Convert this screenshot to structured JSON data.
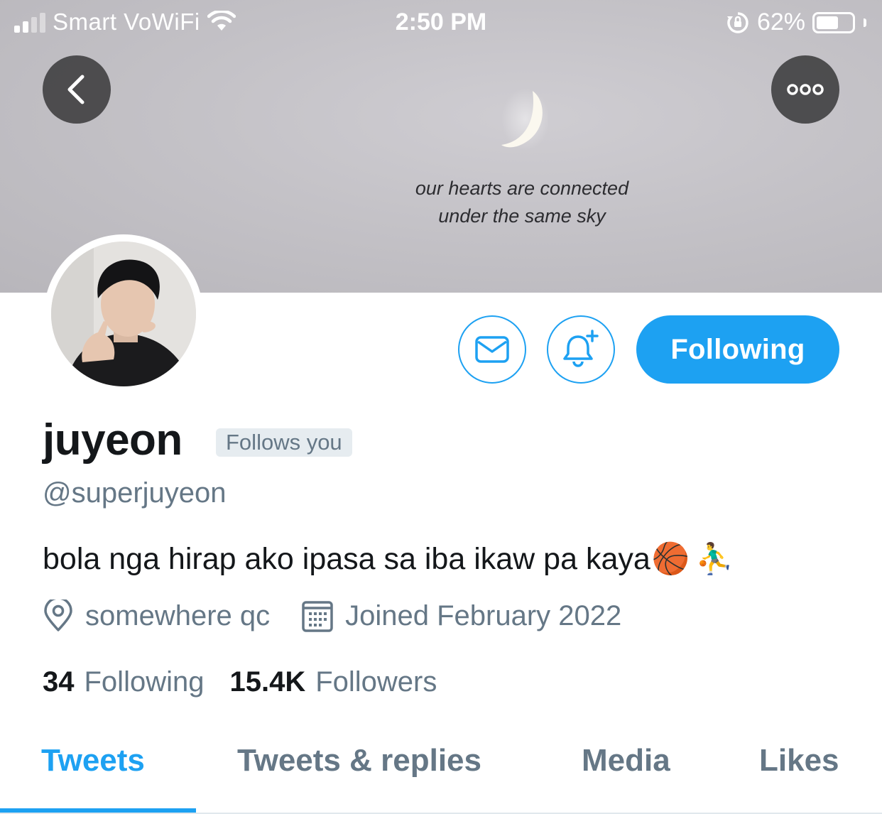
{
  "status_bar": {
    "carrier": "Smart VoWiFi",
    "time": "2:50 PM",
    "battery": "62%",
    "battery_level": 0.62
  },
  "banner": {
    "caption_line1": "our hearts are connected",
    "caption_line2": "under the same sky"
  },
  "nav": {
    "back_icon": "chevron-left-icon",
    "more_icon": "more-horizontal-icon"
  },
  "actions": {
    "message_icon": "mail-icon",
    "notify_icon": "bell-plus-icon",
    "follow_label": "Following"
  },
  "profile": {
    "display_name": "juyeon",
    "follows_you": "Follows you",
    "handle": "@superjuyeon",
    "bio": "bola nga hirap ako ipasa sa iba ikaw pa kaya",
    "bio_emoji": [
      "🏀",
      "⛹️‍♂️"
    ],
    "location": "somewhere qc",
    "joined": "Joined February 2022"
  },
  "stats": {
    "following_count": "34",
    "following_label": "Following",
    "followers_count": "15.4K",
    "followers_label": "Followers"
  },
  "tabs": [
    {
      "label": "Tweets",
      "active": true
    },
    {
      "label": "Tweets & replies",
      "active": false
    },
    {
      "label": "Media",
      "active": false
    },
    {
      "label": "Likes",
      "active": false
    }
  ],
  "colors": {
    "accent": "#1da1f2",
    "secondary_text": "#657786",
    "primary_text": "#14171a"
  }
}
